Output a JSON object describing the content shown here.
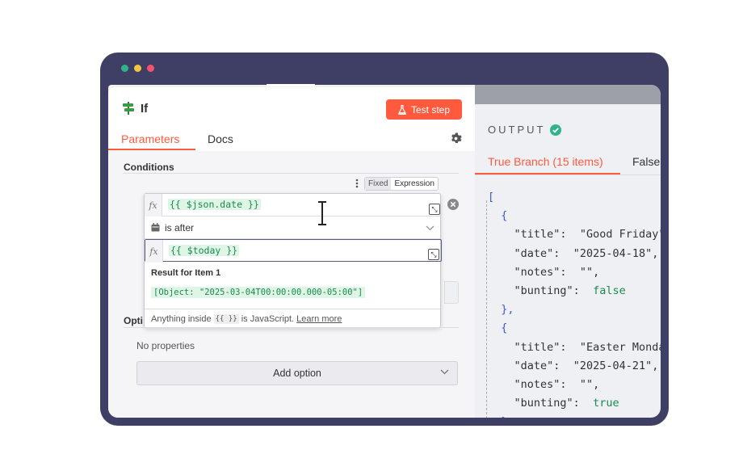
{
  "window": {
    "dots": [
      "#2fb38a",
      "#f5c542",
      "#f2536f"
    ]
  },
  "node": {
    "title": "If",
    "test_button": "Test step",
    "tabs": [
      "Parameters",
      "Docs"
    ]
  },
  "conditions": {
    "section_title": "Conditions",
    "mode_fixed": "Fixed",
    "mode_expression": "Expression",
    "left_value": "{{ $json.date }}",
    "operator": "is after",
    "right_value": "{{ $today }}",
    "result_label": "Result for Item 1",
    "result_value": "[Object: \"2025-03-04T00:00:00.000-05:00\"]",
    "hint_prefix": "Anything inside",
    "hint_code": "{{ }}",
    "hint_suffix": "is JavaScript.",
    "hint_link": "Learn more"
  },
  "options": {
    "section_title": "Opti",
    "no_properties": "No properties",
    "add_option": "Add option"
  },
  "output": {
    "label": "OUTPUT",
    "tab_true": "True Branch (15 items)",
    "tab_false": "False",
    "json_lines": [
      "[",
      "  {",
      "    \"title\":  \"Good Friday\"",
      "    \"date\":  \"2025-04-18\",",
      "    \"notes\":  \"\",",
      "    \"bunting\":  false",
      "  },",
      "  {",
      "    \"title\":  \"Easter Monday",
      "    \"date\":  \"2025-04-21\",",
      "    \"notes\":  \"\",",
      "    \"bunting\":  true",
      "  },"
    ]
  },
  "colors": {
    "accent": "#ff5a3d",
    "frame": "#3f3f66",
    "success": "#2fb38a",
    "expression_green": "#1a8a4f"
  }
}
